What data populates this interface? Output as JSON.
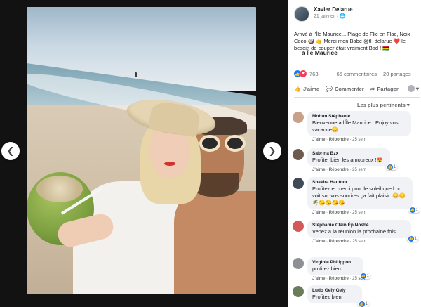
{
  "viewer": {
    "prev_icon": "chevron-left-icon",
    "next_icon": "chevron-right-icon",
    "prev_glyph": "❮",
    "next_glyph": "❯"
  },
  "post": {
    "author": "Xavier Delarue",
    "date": "21 janvier · ",
    "globe_glyph": "🌐",
    "caption": "Arrivé à l’Île Maurice... Plage de Flic en Flac, Noix Coco 🥥 🤙 Merci mon Babe @tl_delarue ❤️ le besoin de couper était vraiment Bad ! 🇲🇺",
    "location": "— à Île Maurice",
    "reactions_count": "763",
    "comments_count": "65 commentaires",
    "shares_count": "20 partages"
  },
  "actions": {
    "like": "J'aime",
    "comment": "Commenter",
    "share": "Partager",
    "like_glyph": "👍",
    "comment_glyph": "💬",
    "share_glyph": "➦",
    "dropdown_glyph": "▾"
  },
  "sort_label": "Les plus pertinents ▾",
  "comments": [
    {
      "name": "Mohun Stéphanie",
      "text": "Bienvenue a l’Île Maurice...Enjoy vos vacance😊",
      "like": "J'aime",
      "reply": "Répondre",
      "time": "25 sem",
      "reaction": "",
      "avatar_color": "#c9a08a"
    },
    {
      "name": "Sabrina Bzx",
      "text": "Profiter bien les amoureux !😍",
      "like": "J'aime",
      "reply": "Répondre",
      "time": "25 sem",
      "reaction": "1",
      "avatar_color": "#6f5a4f"
    },
    {
      "name": "Shakira Hautnor",
      "text": "Profitez et merci pour le soleil que l on voit sur vos sourires ça fait plaisir. 😊😊🌴😘😘😘😘",
      "like": "J'aime",
      "reply": "Répondre",
      "time": "25 sem",
      "reaction": "1",
      "avatar_color": "#3f4a57"
    },
    {
      "name": "Stéphanie Clain Ép Nosbé",
      "text": "Venez a la réunion la prochaine fois",
      "like": "J'aime",
      "reply": "Répondre",
      "time": "25 sem",
      "reaction": "1",
      "avatar_color": "#d45a5a"
    },
    {
      "name": "Virginie Philippon",
      "text": "profitez bien",
      "like": "J'aime",
      "reply": "Répondre",
      "time": "25 sem",
      "reaction": "1",
      "avatar_color": "#8d8f93"
    },
    {
      "name": "Ludo Gely Gely",
      "text": "Profitez bien",
      "like": "",
      "reply": "",
      "time": "",
      "reaction": "1",
      "avatar_color": "#6a7d5a"
    }
  ]
}
